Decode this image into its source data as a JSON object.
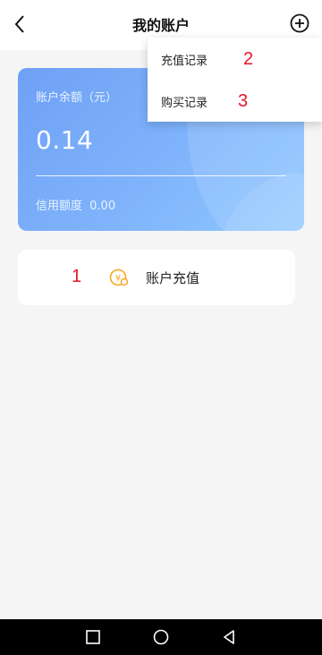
{
  "header": {
    "title": "我的账户",
    "back_icon": "chevron-left-icon",
    "more_icon": "plus-circle-icon"
  },
  "card": {
    "balance_label": "账户余额（元）",
    "balance_value": "0.14",
    "credit_label": "信用额度",
    "credit_value": "0.00",
    "gradient_start": "#6fa0f6",
    "gradient_end": "#8fc8ff"
  },
  "recharge": {
    "label": "账户充值",
    "icon": "yuan-coin-icon",
    "icon_color": "#f5a623"
  },
  "popup_menu": {
    "items": [
      {
        "label": "充值记录"
      },
      {
        "label": "购买记录"
      }
    ]
  },
  "annotations": [
    "1",
    "2",
    "3"
  ],
  "annotation_color": "#e8142a",
  "navbar": {
    "buttons": [
      "square-icon",
      "circle-icon",
      "triangle-back-icon"
    ]
  }
}
